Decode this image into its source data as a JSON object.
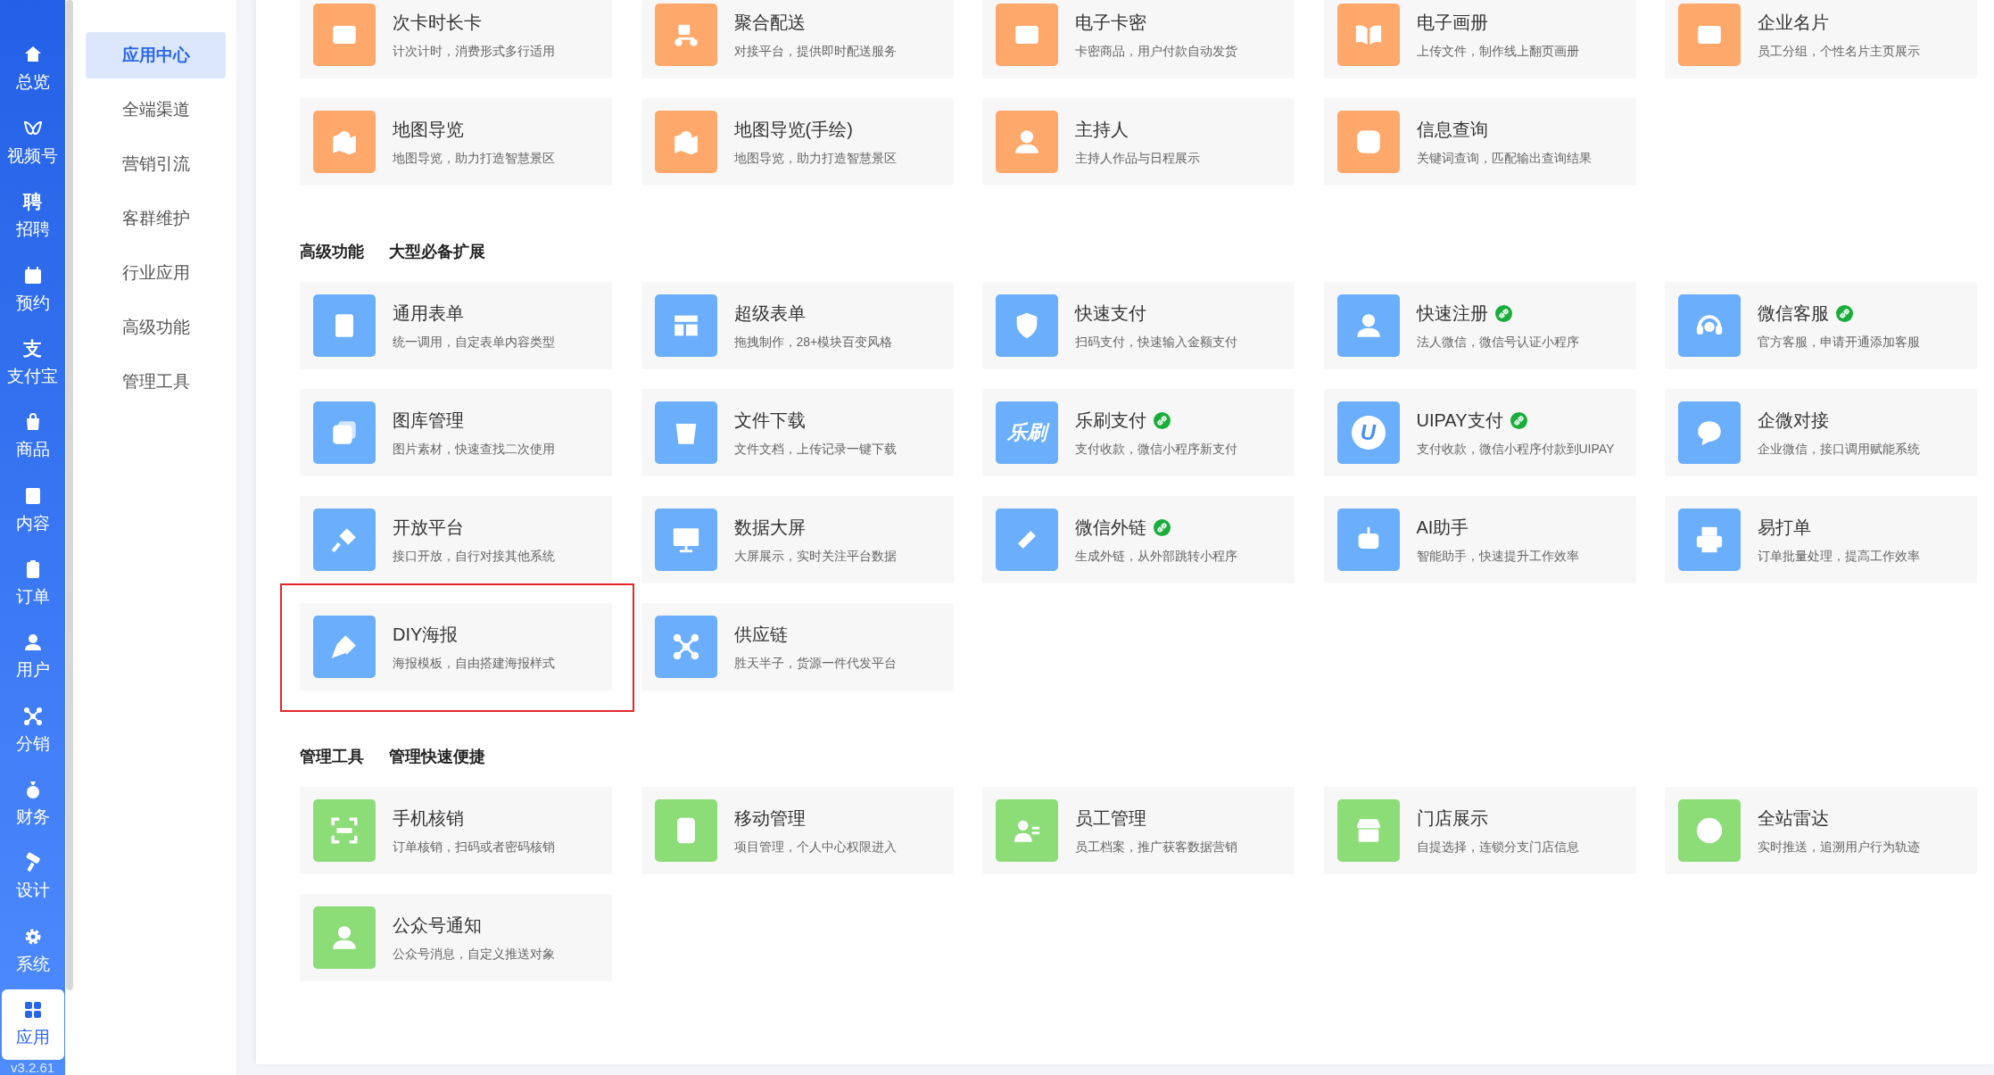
{
  "sidebar": {
    "items": [
      {
        "label": "总览",
        "selected": false
      },
      {
        "label": "视频号",
        "selected": false
      },
      {
        "label": "招聘",
        "selected": false,
        "icon_text": "聘"
      },
      {
        "label": "预约",
        "selected": false
      },
      {
        "label": "支付宝",
        "selected": false,
        "icon_text": "支"
      },
      {
        "label": "商品",
        "selected": false
      },
      {
        "label": "内容",
        "selected": false
      },
      {
        "label": "订单",
        "selected": false
      },
      {
        "label": "用户",
        "selected": false
      },
      {
        "label": "分销",
        "selected": false
      },
      {
        "label": "财务",
        "selected": false
      },
      {
        "label": "设计",
        "selected": false
      },
      {
        "label": "系统",
        "selected": false
      },
      {
        "label": "应用",
        "selected": true
      }
    ],
    "version": "v3.2.61"
  },
  "submenu": {
    "items": [
      {
        "label": "应用中心",
        "selected": true
      },
      {
        "label": "全端渠道",
        "selected": false
      },
      {
        "label": "营销引流",
        "selected": false
      },
      {
        "label": "客群维护",
        "selected": false
      },
      {
        "label": "行业应用",
        "selected": false
      },
      {
        "label": "高级功能",
        "selected": false
      },
      {
        "label": "管理工具",
        "selected": false
      }
    ]
  },
  "sections": [
    {
      "color": "#ffa86b",
      "items": [
        {
          "title": "次卡时长卡",
          "desc": "计次计时，消费形式多行适用",
          "linked": false,
          "highlighted": false
        },
        {
          "title": "聚合配送",
          "desc": "对接平台，提供即时配送服务",
          "linked": false,
          "highlighted": false
        },
        {
          "title": "电子卡密",
          "desc": "卡密商品，用户付款自动发货",
          "linked": false,
          "highlighted": false
        },
        {
          "title": "电子画册",
          "desc": "上传文件，制作线上翻页画册",
          "linked": false,
          "highlighted": false
        },
        {
          "title": "企业名片",
          "desc": "员工分组，个性名片主页展示",
          "linked": false,
          "highlighted": false
        },
        {
          "title": "地图导览",
          "desc": "地图导览，助力打造智慧景区",
          "linked": false,
          "highlighted": false
        },
        {
          "title": "地图导览(手绘)",
          "desc": "地图导览，助力打造智慧景区",
          "linked": false,
          "highlighted": false
        },
        {
          "title": "主持人",
          "desc": "主持人作品与日程展示",
          "linked": false,
          "highlighted": false
        },
        {
          "title": "信息查询",
          "desc": "关键词查询，匹配输出查询结果",
          "linked": false,
          "highlighted": false
        }
      ]
    },
    {
      "title": "高级功能",
      "subtitle": "大型必备扩展",
      "color": "#6aaefc",
      "items": [
        {
          "title": "通用表单",
          "desc": "统一调用，自定表单内容类型",
          "linked": false,
          "highlighted": false
        },
        {
          "title": "超级表单",
          "desc": "拖拽制作，28+模块百变风格",
          "linked": false,
          "highlighted": false
        },
        {
          "title": "快速支付",
          "desc": "扫码支付，快速输入金额支付",
          "linked": false,
          "highlighted": false
        },
        {
          "title": "快速注册",
          "desc": "法人微信，微信号认证小程序",
          "linked": true,
          "highlighted": false
        },
        {
          "title": "微信客服",
          "desc": "官方客服，申请开通添加客服",
          "linked": true,
          "highlighted": false
        },
        {
          "title": "图库管理",
          "desc": "图片素材，快速查找二次使用",
          "linked": false,
          "highlighted": false
        },
        {
          "title": "文件下载",
          "desc": "文件文档，上传记录一键下载",
          "linked": false,
          "highlighted": false
        },
        {
          "title": "乐刷支付",
          "desc": "支付收款，微信小程序新支付",
          "linked": true,
          "highlighted": false,
          "icon_text": "乐刷"
        },
        {
          "title": "UIPAY支付",
          "desc": "支付收款，微信小程序付款到UIPAY",
          "linked": true,
          "highlighted": false,
          "icon_text": "U"
        },
        {
          "title": "企微对接",
          "desc": "企业微信，接口调用赋能系统",
          "linked": false,
          "highlighted": false
        },
        {
          "title": "开放平台",
          "desc": "接口开放，自行对接其他系统",
          "linked": false,
          "highlighted": false
        },
        {
          "title": "数据大屏",
          "desc": "大屏展示，实时关注平台数据",
          "linked": false,
          "highlighted": false
        },
        {
          "title": "微信外链",
          "desc": "生成外链，从外部跳转小程序",
          "linked": true,
          "highlighted": false
        },
        {
          "title": "AI助手",
          "desc": "智能助手，快速提升工作效率",
          "linked": false,
          "highlighted": false
        },
        {
          "title": "易打单",
          "desc": "订单批量处理，提高工作效率",
          "linked": false,
          "highlighted": false
        },
        {
          "title": "DIY海报",
          "desc": "海报模板，自由搭建海报样式",
          "linked": false,
          "highlighted": true
        },
        {
          "title": "供应链",
          "desc": "胜天半子，货源一件代发平台",
          "linked": false,
          "highlighted": false
        }
      ]
    },
    {
      "title": "管理工具",
      "subtitle": "管理快速便捷",
      "color": "#8cdc78",
      "items": [
        {
          "title": "手机核销",
          "desc": "订单核销，扫码或者密码核销",
          "linked": false,
          "highlighted": false
        },
        {
          "title": "移动管理",
          "desc": "项目管理，个人中心权限进入",
          "linked": false,
          "highlighted": false
        },
        {
          "title": "员工管理",
          "desc": "员工档案，推广获客数据营销",
          "linked": false,
          "highlighted": false
        },
        {
          "title": "门店展示",
          "desc": "自提选择，连锁分支门店信息",
          "linked": false,
          "highlighted": false
        },
        {
          "title": "全站雷达",
          "desc": "实时推送，追溯用户行为轨迹",
          "linked": false,
          "highlighted": false
        },
        {
          "title": "公众号通知",
          "desc": "公众号消息，自定义推送对象",
          "linked": false,
          "highlighted": false
        }
      ]
    }
  ]
}
